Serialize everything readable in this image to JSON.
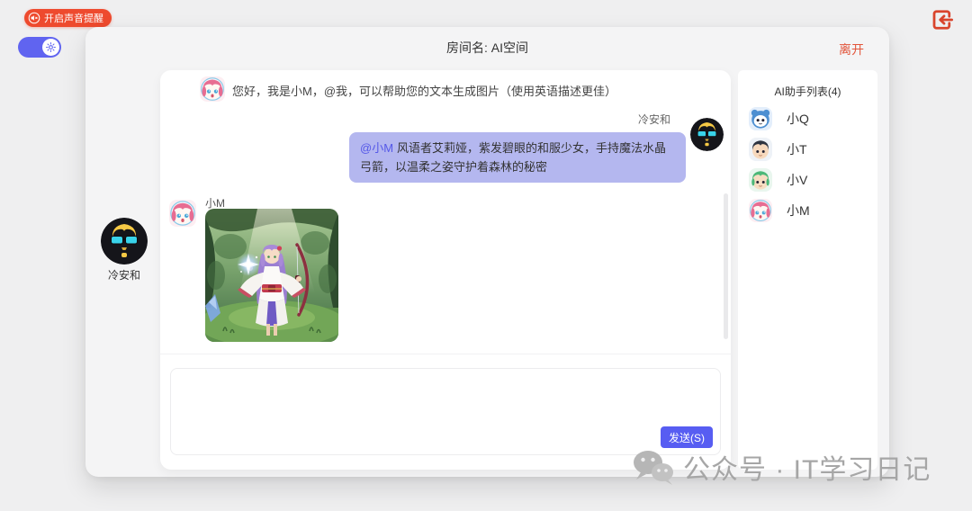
{
  "colors": {
    "accent_red": "#ee4a2e",
    "leave_red": "#e2553b",
    "accent_purple": "#575df2",
    "bubble_purple": "#b4b7ef",
    "mention_purple": "#5558e8"
  },
  "topbar": {
    "sound_button_label": "开启声音提醒"
  },
  "header": {
    "room_label": "房间名: AI空间",
    "leave_label": "离开"
  },
  "member_panel": {
    "name": "冷安和"
  },
  "chat": {
    "messages": [
      {
        "sender": "小M",
        "text": "您好，我是小M，@我，可以帮助您的文本生成图片（使用英语描述更佳）"
      },
      {
        "sender": "冷安和",
        "mention": "@小M",
        "text": "风语者艾莉娅，紫发碧眼的和服少女，手持魔法水晶弓箭，以温柔之姿守护着森林的秘密"
      },
      {
        "sender": "小M",
        "image_desc": "紫发和服少女手持魔法水晶弓箭站在森林中"
      }
    ],
    "input": {
      "value": "",
      "send_label": "发送(S)"
    }
  },
  "sidebar": {
    "title": "AI助手列表(4)",
    "assistants": [
      {
        "name": "小Q"
      },
      {
        "name": "小T"
      },
      {
        "name": "小V"
      },
      {
        "name": "小M"
      }
    ]
  },
  "watermark": {
    "text": "公众号 · IT学习日记"
  }
}
